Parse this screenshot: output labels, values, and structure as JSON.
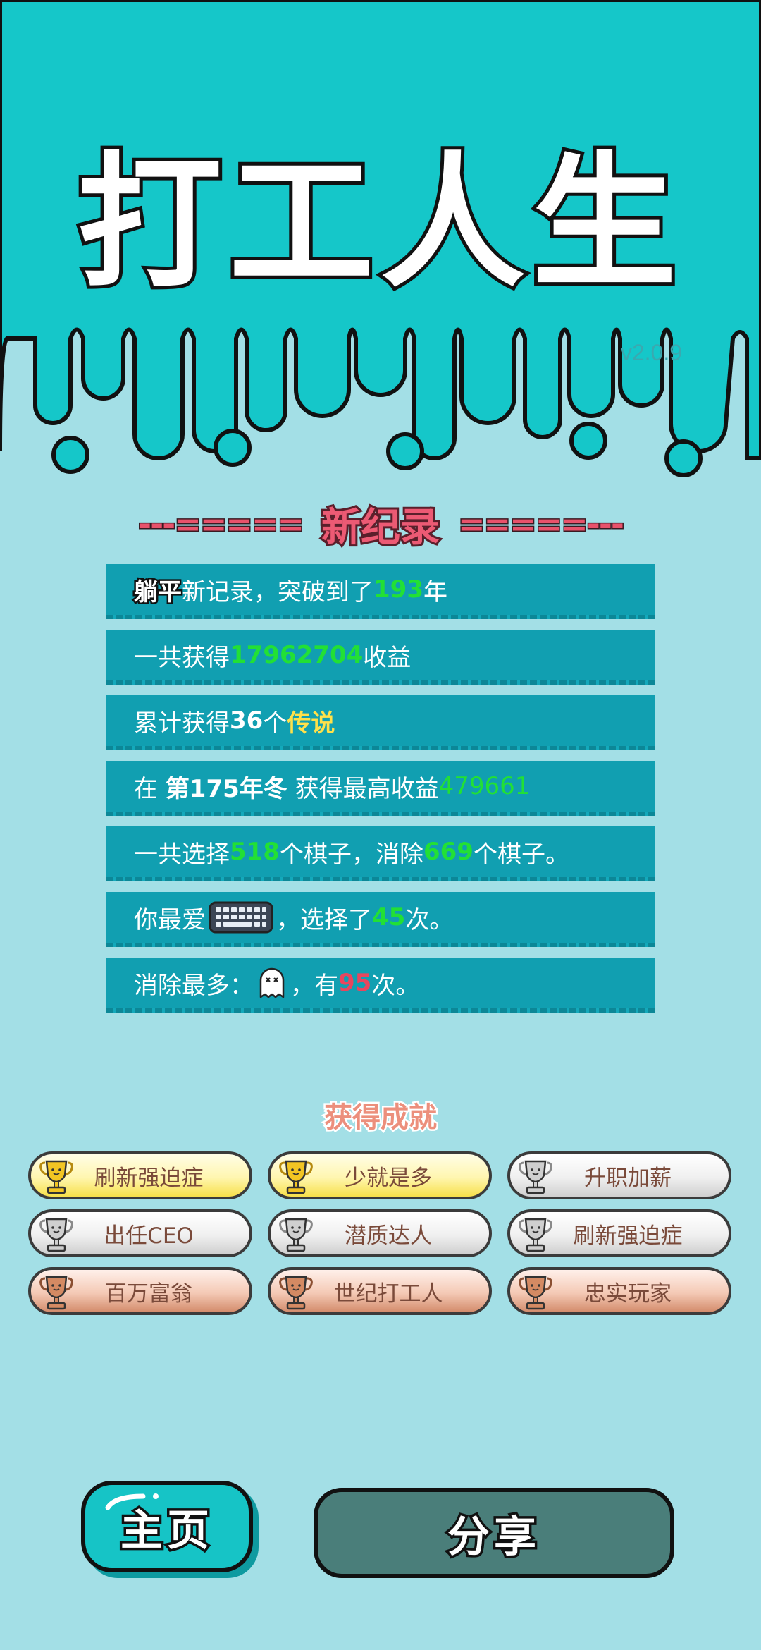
{
  "header": {
    "title": "打工人生",
    "version": "v2.0.9"
  },
  "record": {
    "title": "新纪录",
    "dash_left": "---=====",
    "dash_right": "=====---"
  },
  "stats": {
    "row1": {
      "name": "躺平",
      "text_a": "新记录，突破到了",
      "value": "193",
      "text_b": "年"
    },
    "row2": {
      "text_a": "一共获得",
      "value": "17962704",
      "text_b": "收益"
    },
    "row3": {
      "text_a": "累计获得",
      "value": "36",
      "text_b": "个",
      "tier": "传说"
    },
    "row4": {
      "text_a": "在 ",
      "season": "第175年冬",
      "text_b": " 获得最高收益",
      "value": "479661"
    },
    "row5": {
      "text_a": "一共选择",
      "value_a": "518",
      "text_b": "个棋子，消除",
      "value_b": "669",
      "text_c": "个棋子。"
    },
    "row6": {
      "text_a": "你最爱",
      "icon": "keyboard-icon",
      "text_b": "，选择了",
      "value": "45",
      "text_c": "次。"
    },
    "row7": {
      "text_a": "消除最多：",
      "icon": "ghost-icon",
      "text_b": "，有",
      "value": "95",
      "text_c": "次。"
    }
  },
  "achievements": {
    "title": "获得成就",
    "items": [
      {
        "label": "刷新强迫症",
        "tier": "gold"
      },
      {
        "label": "少就是多",
        "tier": "gold"
      },
      {
        "label": "升职加薪",
        "tier": "silver"
      },
      {
        "label": "出任CEO",
        "tier": "silver"
      },
      {
        "label": "潜质达人",
        "tier": "silver"
      },
      {
        "label": "刷新强迫症",
        "tier": "silver"
      },
      {
        "label": "百万富翁",
        "tier": "bronze"
      },
      {
        "label": "世纪打工人",
        "tier": "bronze"
      },
      {
        "label": "忠实玩家",
        "tier": "bronze"
      }
    ]
  },
  "buttons": {
    "home": "主页",
    "share": "分享"
  },
  "colors": {
    "top_bg": "#15c7c9",
    "page_bg": "#a3dfe6",
    "row_bg": "#119fb1",
    "accent_green": "#22e035",
    "accent_red": "#e8465e",
    "accent_yellow": "#ffe14a"
  }
}
